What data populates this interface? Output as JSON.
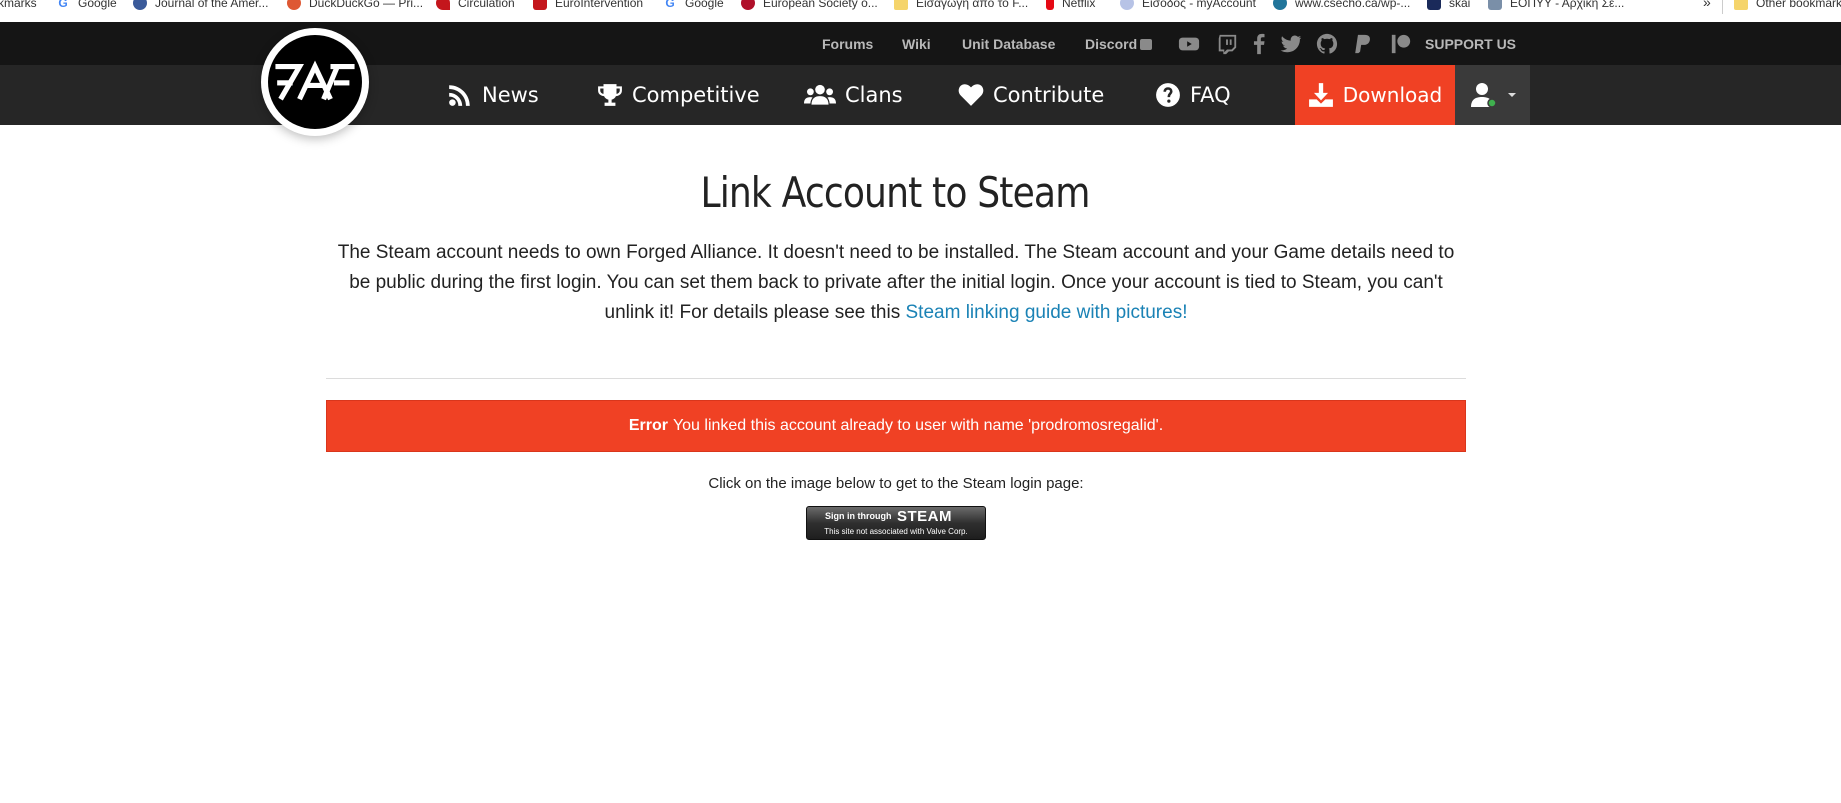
{
  "bookmarks": {
    "items": [
      {
        "label": "kmarks",
        "icon": "none"
      },
      {
        "label": "Google",
        "icon": "google-icon"
      },
      {
        "label": "Journal of the Amer...",
        "icon": "journal-icon"
      },
      {
        "label": "DuckDuckGo — Pri...",
        "icon": "duckduckgo-icon"
      },
      {
        "label": "Circulation",
        "icon": "circulation-icon"
      },
      {
        "label": "EuroIntervention",
        "icon": "eurointervention-icon"
      },
      {
        "label": "Google",
        "icon": "google-icon"
      },
      {
        "label": "European Society o...",
        "icon": "esc-icon"
      },
      {
        "label": "Εισαγωγή από το F...",
        "icon": "folder-icon"
      },
      {
        "label": "Netflix",
        "icon": "netflix-icon"
      },
      {
        "label": "Είσοδος - myAccount",
        "icon": "myaccount-icon"
      },
      {
        "label": "www.csecho.ca/wp-...",
        "icon": "wordpress-icon"
      },
      {
        "label": "skai",
        "icon": "skai-icon"
      },
      {
        "label": "ΕΟΠΥΥ - Αρχική Σε...",
        "icon": "eopyy-icon"
      }
    ],
    "more": "»",
    "other": "Other bookmarks"
  },
  "topbar": {
    "links": [
      "Forums",
      "Wiki",
      "Unit Database",
      "Discord"
    ],
    "social_icons": [
      "youtube-icon",
      "twitch-icon",
      "facebook-icon",
      "twitter-icon",
      "github-icon",
      "paypal-icon",
      "patreon-icon"
    ],
    "support": "SUPPORT US"
  },
  "nav": {
    "items": [
      {
        "label": "News",
        "icon": "rss-icon"
      },
      {
        "label": "Competitive",
        "icon": "trophy-icon"
      },
      {
        "label": "Clans",
        "icon": "users-icon"
      },
      {
        "label": "Contribute",
        "icon": "heart-icon"
      },
      {
        "label": "FAQ",
        "icon": "question-icon"
      }
    ],
    "download": "Download"
  },
  "page": {
    "title": "Link Account to Steam",
    "intro": "The Steam account needs to own Forged Alliance. It doesn't need to be installed. The Steam account and your Game details need to be public during the first login. You can set them back to private after the initial login. Once your account is tied to Steam, you can't unlink it! For details please see this ",
    "guide_link": "Steam linking guide with pictures!",
    "error_label": "Error",
    "error_message": "You linked this account already to user with name 'prodromosregalid'.",
    "click_text": "Click on the image below to get to the Steam login page:",
    "steam_button": {
      "line1": "Sign in through",
      "line2": "STEAM",
      "line3": "This site not associated with Valve Corp."
    }
  },
  "colors": {
    "accent": "#f04124",
    "link": "#1a82b5",
    "topbar": "#151515",
    "nav": "#262626"
  }
}
